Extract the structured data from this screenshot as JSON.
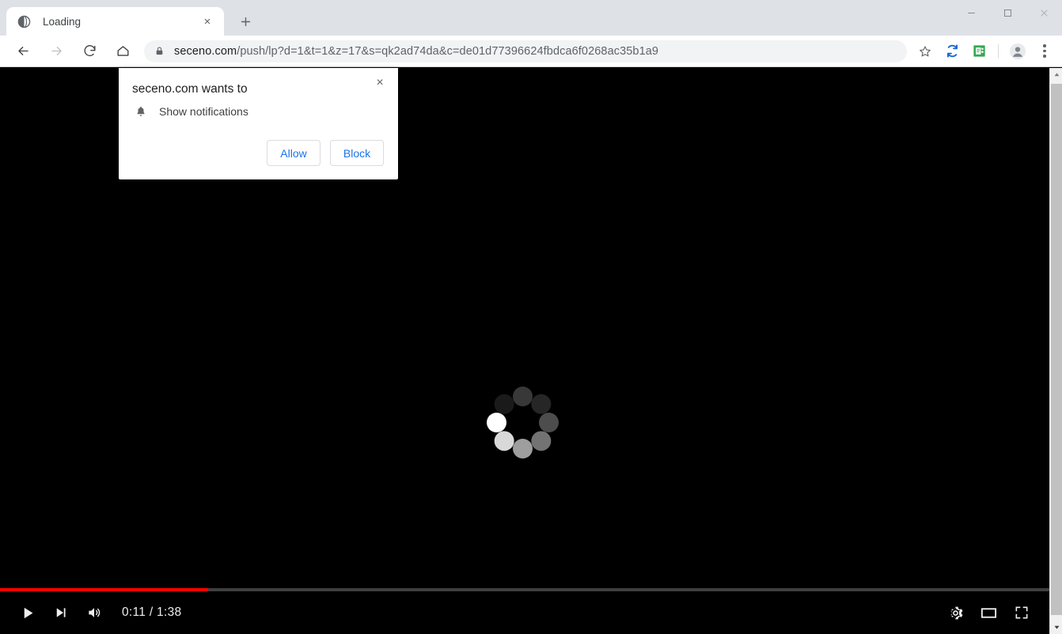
{
  "window": {
    "minimize_label": "Minimize",
    "maximize_label": "Maximize",
    "close_label": "Close"
  },
  "tabstrip": {
    "tabs": [
      {
        "title": "Loading",
        "favicon": "globe-icon",
        "close_label": "×"
      }
    ],
    "new_tab_label": "+"
  },
  "toolbar": {
    "back_label": "Back",
    "forward_label": "Forward",
    "reload_label": "Reload",
    "home_label": "Home",
    "url_host": "seceno.com",
    "url_path": "/push/lp?d=1&t=1&z=17&s=qk2ad74da&c=de01d77396624fbdca6f0268ac35b1a9",
    "url_full": "seceno.com/push/lp?d=1&t=1&z=17&s=qk2ad74da&c=de01d77396624fbdca6f0268ac35b1a9",
    "lock_icon": "lock-icon",
    "bookmark_icon": "star-icon",
    "extensions": [
      {
        "name": "sync-extension-icon",
        "color": "#1a73e8"
      },
      {
        "name": "document-extension-icon",
        "color": "#34a853"
      }
    ],
    "profile_icon": "avatar-icon",
    "menu_icon": "three-dot-menu-icon"
  },
  "permission_dialog": {
    "title": "seceno.com wants to",
    "permission_icon": "bell-icon",
    "permission_label": "Show notifications",
    "allow_label": "Allow",
    "block_label": "Block",
    "close_label": "×"
  },
  "page": {
    "background_color": "#000000",
    "spinner_icon": "loading-spinner-icon",
    "spinner_dot_count": 8
  },
  "video_controls": {
    "play_label": "Play",
    "next_label": "Next",
    "volume_label": "Volume",
    "time_display": "0:11 / 1:38",
    "current_time": "0:11",
    "duration": "1:38",
    "progress_percent": 19.8,
    "progress_color": "#ff0000",
    "settings_label": "Settings",
    "theater_label": "Theater mode",
    "fullscreen_label": "Full screen"
  },
  "scrollbar": {
    "up_label": "Scroll up",
    "down_label": "Scroll down",
    "thumb_label": "Scroll thumb"
  }
}
